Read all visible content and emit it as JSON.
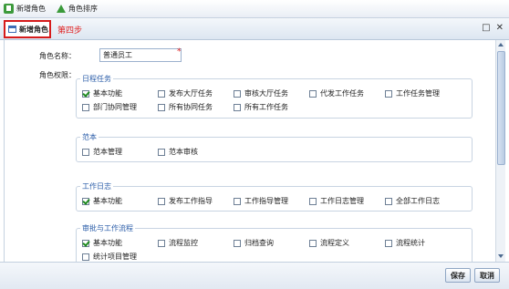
{
  "toolbar": {
    "new_role_label": "新增角色",
    "role_sort_label": "角色排序"
  },
  "panel": {
    "title": "新增角色",
    "step_note": "第四步",
    "restore_icon": "□",
    "close_icon": "✕"
  },
  "form": {
    "role_name_label": "角色名称：",
    "role_name_value": "普通员工",
    "required_mark": "*",
    "permissions_label": "角色权限："
  },
  "groups": [
    {
      "title": "日程任务",
      "items": [
        {
          "label": "基本功能",
          "checked": true
        },
        {
          "label": "发布大厅任务",
          "checked": false
        },
        {
          "label": "审核大厅任务",
          "checked": false
        },
        {
          "label": "代发工作任务",
          "checked": false
        },
        {
          "label": "工作任务管理",
          "checked": false
        },
        {
          "label": "部门协同管理",
          "checked": false
        },
        {
          "label": "所有协同任务",
          "checked": false
        },
        {
          "label": "所有工作任务",
          "checked": false
        }
      ]
    },
    {
      "title": "范本",
      "items": [
        {
          "label": "范本管理",
          "checked": false
        },
        {
          "label": "范本审核",
          "checked": false
        }
      ]
    },
    {
      "title": "工作日志",
      "items": [
        {
          "label": "基本功能",
          "checked": true
        },
        {
          "label": "发布工作指导",
          "checked": false
        },
        {
          "label": "工作指导管理",
          "checked": false
        },
        {
          "label": "工作日志管理",
          "checked": false
        },
        {
          "label": "全部工作日志",
          "checked": false
        }
      ]
    },
    {
      "title": "审批与工作流程",
      "items": [
        {
          "label": "基本功能",
          "checked": true
        },
        {
          "label": "流程监控",
          "checked": false
        },
        {
          "label": "归档查询",
          "checked": false
        },
        {
          "label": "流程定义",
          "checked": false
        },
        {
          "label": "流程统计",
          "checked": false
        },
        {
          "label": "统计项目管理",
          "checked": false
        }
      ]
    }
  ],
  "footer": {
    "save_label": "保存",
    "cancel_label": "取消"
  }
}
